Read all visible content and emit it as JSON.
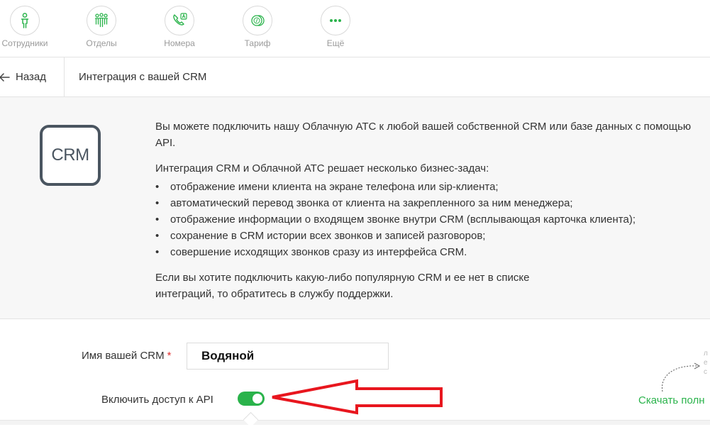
{
  "topnav": {
    "items": [
      {
        "label": "Сотрудники",
        "icon": "person-icon"
      },
      {
        "label": "Отделы",
        "icon": "group-icon"
      },
      {
        "label": "Номера",
        "icon": "phone-number-icon"
      },
      {
        "label": "Тариф",
        "icon": "coins-icon"
      },
      {
        "label": "Ещё",
        "icon": "more-dots-icon"
      }
    ]
  },
  "breadcrumb": {
    "back_label": "Назад",
    "title": "Интеграция с вашей CRM"
  },
  "info": {
    "logo_text": "CRM",
    "intro": "Вы можете подключить нашу Облачную АТС к любой вашей собственной CRM или базе данных с помощью API.",
    "tasks_heading": "Интеграция CRM и Облачной АТС решает несколько бизнес-задач:",
    "tasks": [
      "отображение имени клиента на экране телефона или sip-клиента;",
      "автоматический перевод звонка от клиента на закрепленного за ним менеджера;",
      "отображение информации о входящем звонке внутри CRM (всплывающая карточка клиента);",
      "сохранение в CRM истории всех звонков и записей разговоров;",
      "совершение исходящих звонков сразу из интерфейса CRM."
    ],
    "outro": "Если вы хотите подключить какую-либо популярную CRM и ее нет в списке интеграций, то обратитесь в службу поддержки."
  },
  "form": {
    "name_label": "Имя вашей CRM",
    "required_mark": "*",
    "name_value": "Водяной",
    "api_label": "Включить доступ к API",
    "api_enabled": true,
    "download_link": "Скачать полн",
    "side_hint": [
      "л",
      "е",
      "с"
    ]
  },
  "colors": {
    "accent": "#2ab34b",
    "annotation_arrow": "#e8161e",
    "logo": "#4a5560"
  }
}
